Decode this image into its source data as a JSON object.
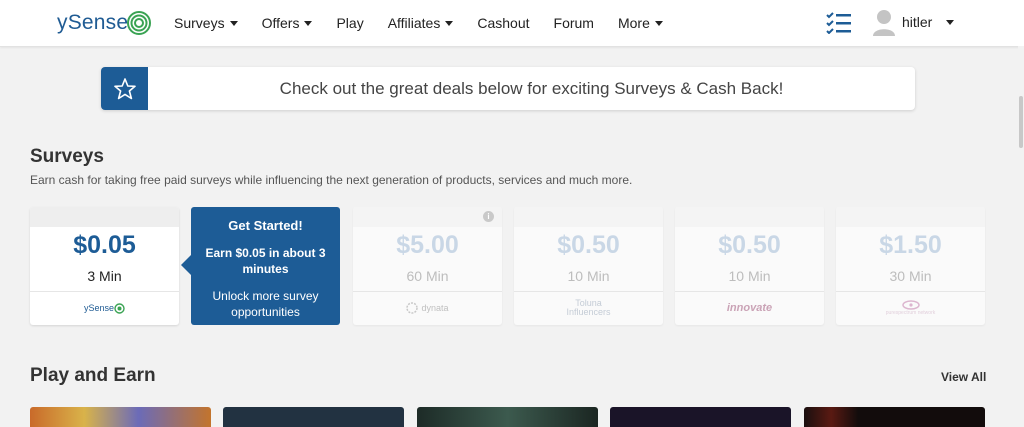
{
  "header": {
    "logo_text": "ySense",
    "nav": [
      {
        "label": "Surveys",
        "dropdown": true
      },
      {
        "label": "Offers",
        "dropdown": true
      },
      {
        "label": "Play",
        "dropdown": false
      },
      {
        "label": "Affiliates",
        "dropdown": true
      },
      {
        "label": "Cashout",
        "dropdown": false
      },
      {
        "label": "Forum",
        "dropdown": false
      },
      {
        "label": "More",
        "dropdown": true
      }
    ],
    "username": "hitler"
  },
  "banner": {
    "text": "Check out the great deals below for exciting Surveys & Cash Back!",
    "icon": "star-icon"
  },
  "surveys": {
    "title": "Surveys",
    "subtitle": "Earn cash for taking free paid surveys while influencing the next generation of products, services and much more.",
    "cards": [
      {
        "price": "$0.05",
        "time": "3 Min",
        "provider": "ySense",
        "active": true
      },
      {
        "price": "$5.00",
        "time": "60 Min",
        "provider": "dynata",
        "active": false
      },
      {
        "price": "$0.50",
        "time": "10 Min",
        "provider": "Toluna Influencers",
        "active": false
      },
      {
        "price": "$0.50",
        "time": "10 Min",
        "provider": "innovate",
        "active": false
      },
      {
        "price": "$1.50",
        "time": "30 Min",
        "provider": "purespectrum network",
        "active": false
      }
    ],
    "cta": {
      "title": "Get Started!",
      "line": "Earn $0.05 in about 3 minutes",
      "sub": "Unlock more survey opportunities"
    }
  },
  "play": {
    "title": "Play and Earn",
    "view_all": "View All"
  },
  "colors": {
    "brand": "#1d5c96",
    "background": "#f2f2f2",
    "faded_price": "#c9d7e6"
  }
}
